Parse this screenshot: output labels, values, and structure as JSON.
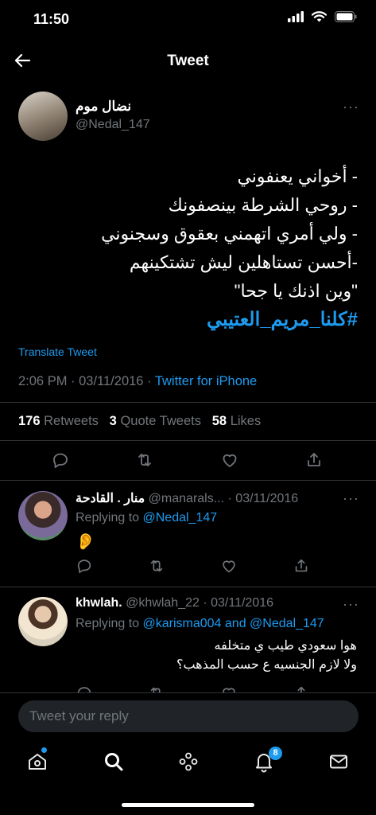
{
  "status_bar": {
    "time": "11:50"
  },
  "header": {
    "title": "Tweet"
  },
  "tweet": {
    "author_name": "نضال موم",
    "author_handle": "@Nedal_147",
    "lines": [
      "- أخواني يعنفوني",
      "- روحي الشرطة بينصفونك",
      "- ولي أمري اتهمني بعقوق وسجنوني",
      "-أحسن تستاهلين ليش تشتكينهم",
      "\"وين اذنك يا جحا\""
    ],
    "hashtag": "#كلنا_مريم_العتيبي",
    "translate_label": "Translate Tweet",
    "timestamp": "2:06 PM · 03/11/2016 ·",
    "source": "Twitter for iPhone",
    "stats": {
      "retweets_count": "176",
      "retweets_label": "Retweets",
      "quotes_count": "3",
      "quotes_label": "Quote Tweets",
      "likes_count": "58",
      "likes_label": "Likes"
    }
  },
  "replies": [
    {
      "name": "منار . القادحة",
      "handle": "@manarals...",
      "date": "· 03/11/2016",
      "replying_prefix": "Replying to",
      "replying_to": "@Nedal_147",
      "body": "👂"
    },
    {
      "name": "khwlah.",
      "handle": "@khwlah_22",
      "date": "· 03/11/2016",
      "replying_prefix": "Replying to",
      "replying_to": "@karisma004 and @Nedal_147",
      "lines": [
        "هوا سعودي طيب ي متخلفه",
        "ولا لازم الجنسيه ع حسب المذهب؟"
      ]
    }
  ],
  "composer": {
    "placeholder": "Tweet your reply"
  },
  "tabbar": {
    "notifications_badge": "8"
  },
  "colors": {
    "accent": "#1d9bf0",
    "background": "#000000",
    "secondary_text": "#71767b"
  }
}
